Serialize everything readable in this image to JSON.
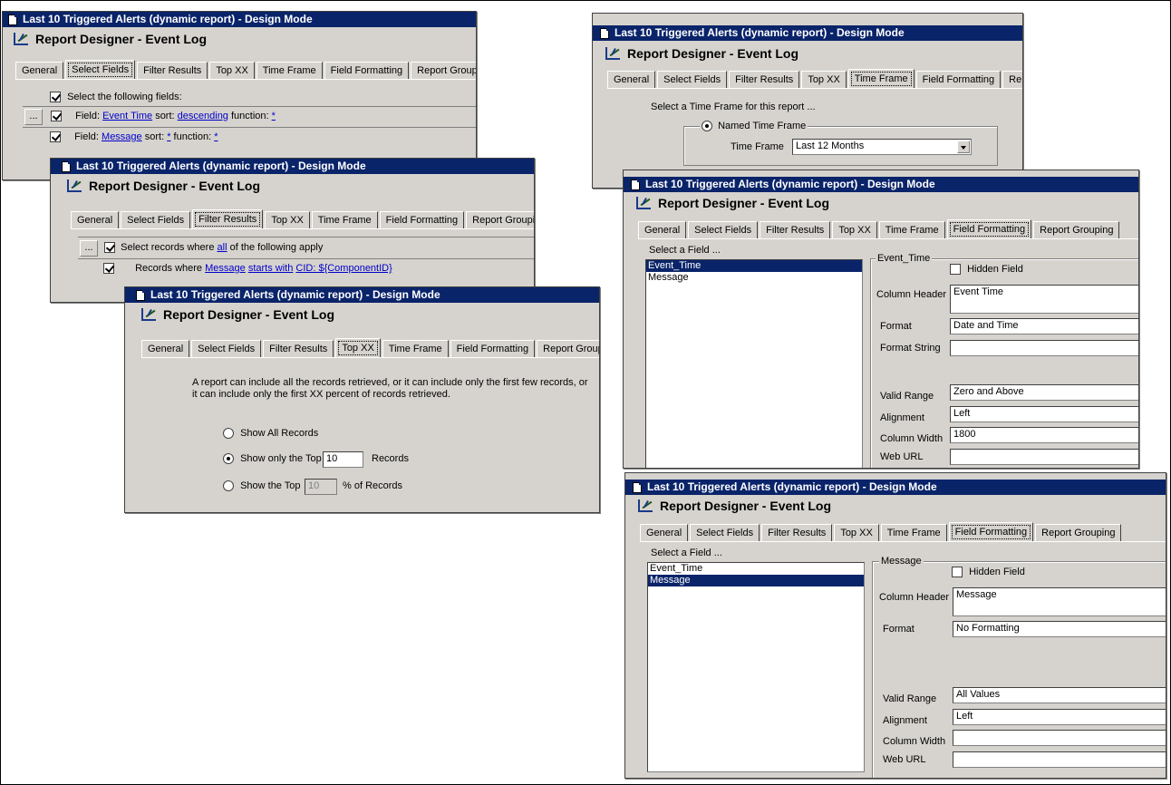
{
  "common": {
    "title": "Last 10 Triggered Alerts (dynamic report) - Design Mode",
    "heading": "Report Designer - Event Log",
    "tabs": [
      "General",
      "Select Fields",
      "Filter Results",
      "Top XX",
      "Time Frame",
      "Field Formatting",
      "Report Grouping"
    ],
    "tabs_truncated_last": "Report Grou"
  },
  "select_fields": {
    "header_label": "Select the following fields:",
    "row1": {
      "field_label": "Field:",
      "field": "Event Time",
      "sort_label": "sort:",
      "sort": "descending",
      "function_label": "function:",
      "function": "*"
    },
    "row2": {
      "field_label": "Field:",
      "field": "Message",
      "sort_label": "sort:",
      "sort": "*",
      "function_label": "function:",
      "function": "*"
    },
    "ellipsis": "..."
  },
  "filter_results": {
    "ellipsis": "...",
    "line1_pre": "Select records where",
    "line1_link": "all",
    "line1_post": "of the following apply",
    "line2_pre": "Records where",
    "line2_field": "Message",
    "line2_op": "starts with",
    "line2_value": "CID: ${ComponentID}"
  },
  "top_xx": {
    "description_line1": "A report can include all the records retrieved, or it can include only the first few records, or",
    "description_line2": "it can include only the first XX percent of records retrieved.",
    "opt_all": "Show All Records",
    "opt_top_pre": "Show only the Top",
    "opt_top_value": "10",
    "opt_top_post": "Records",
    "opt_pct_pre": "Show the Top",
    "opt_pct_value": "10",
    "opt_pct_post": "% of Records"
  },
  "time_frame": {
    "prompt": "Select a Time Frame for this report ...",
    "group_label": "Named Time Frame",
    "field_label": "Time Frame",
    "value": "Last 12 Months"
  },
  "formatting_event": {
    "select_label": "Select a Field ...",
    "list": [
      "Event_Time",
      "Message"
    ],
    "group_label": "Event_Time",
    "hidden_label": "Hidden Field",
    "column_header_label": "Column Header",
    "column_header": "Event Time",
    "format_label": "Format",
    "format": "Date and Time",
    "format_string_label": "Format String",
    "format_string": "",
    "valid_range_label": "Valid Range",
    "valid_range": "Zero and Above",
    "alignment_label": "Alignment",
    "alignment": "Left",
    "column_width_label": "Column Width",
    "column_width": "1800",
    "web_url_label": "Web URL",
    "web_url": ""
  },
  "formatting_message": {
    "select_label": "Select a Field ...",
    "list": [
      "Event_Time",
      "Message"
    ],
    "group_label": "Message",
    "hidden_label": "Hidden Field",
    "column_header_label": "Column Header",
    "column_header": "Message",
    "format_label": "Format",
    "format": "No Formatting",
    "valid_range_label": "Valid Range",
    "valid_range": "All Values",
    "alignment_label": "Alignment",
    "alignment": "Left",
    "column_width_label": "Column Width",
    "column_width": "",
    "web_url_label": "Web URL",
    "web_url": ""
  }
}
